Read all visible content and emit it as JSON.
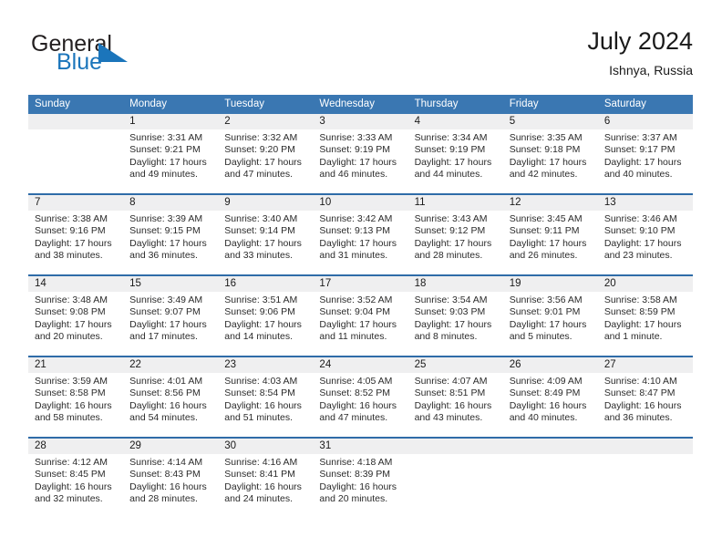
{
  "brand": {
    "name_part1": "General",
    "name_part2": "Blue",
    "mark": "triangle-flag-icon"
  },
  "header": {
    "title": "July 2024",
    "location": "Ishnya, Russia"
  },
  "calendar": {
    "weekday_headers": [
      "Sunday",
      "Monday",
      "Tuesday",
      "Wednesday",
      "Thursday",
      "Friday",
      "Saturday"
    ],
    "colors": {
      "header_blue": "#3a77b2",
      "row_rule_blue": "#2f6ca8",
      "number_band": "#efeff0",
      "brand_blue": "#1b75bb"
    },
    "weeks": [
      [
        {
          "day": "",
          "lines": []
        },
        {
          "day": "1",
          "lines": [
            "Sunrise: 3:31 AM",
            "Sunset: 9:21 PM",
            "Daylight: 17 hours",
            "and 49 minutes."
          ]
        },
        {
          "day": "2",
          "lines": [
            "Sunrise: 3:32 AM",
            "Sunset: 9:20 PM",
            "Daylight: 17 hours",
            "and 47 minutes."
          ]
        },
        {
          "day": "3",
          "lines": [
            "Sunrise: 3:33 AM",
            "Sunset: 9:19 PM",
            "Daylight: 17 hours",
            "and 46 minutes."
          ]
        },
        {
          "day": "4",
          "lines": [
            "Sunrise: 3:34 AM",
            "Sunset: 9:19 PM",
            "Daylight: 17 hours",
            "and 44 minutes."
          ]
        },
        {
          "day": "5",
          "lines": [
            "Sunrise: 3:35 AM",
            "Sunset: 9:18 PM",
            "Daylight: 17 hours",
            "and 42 minutes."
          ]
        },
        {
          "day": "6",
          "lines": [
            "Sunrise: 3:37 AM",
            "Sunset: 9:17 PM",
            "Daylight: 17 hours",
            "and 40 minutes."
          ]
        }
      ],
      [
        {
          "day": "7",
          "lines": [
            "Sunrise: 3:38 AM",
            "Sunset: 9:16 PM",
            "Daylight: 17 hours",
            "and 38 minutes."
          ]
        },
        {
          "day": "8",
          "lines": [
            "Sunrise: 3:39 AM",
            "Sunset: 9:15 PM",
            "Daylight: 17 hours",
            "and 36 minutes."
          ]
        },
        {
          "day": "9",
          "lines": [
            "Sunrise: 3:40 AM",
            "Sunset: 9:14 PM",
            "Daylight: 17 hours",
            "and 33 minutes."
          ]
        },
        {
          "day": "10",
          "lines": [
            "Sunrise: 3:42 AM",
            "Sunset: 9:13 PM",
            "Daylight: 17 hours",
            "and 31 minutes."
          ]
        },
        {
          "day": "11",
          "lines": [
            "Sunrise: 3:43 AM",
            "Sunset: 9:12 PM",
            "Daylight: 17 hours",
            "and 28 minutes."
          ]
        },
        {
          "day": "12",
          "lines": [
            "Sunrise: 3:45 AM",
            "Sunset: 9:11 PM",
            "Daylight: 17 hours",
            "and 26 minutes."
          ]
        },
        {
          "day": "13",
          "lines": [
            "Sunrise: 3:46 AM",
            "Sunset: 9:10 PM",
            "Daylight: 17 hours",
            "and 23 minutes."
          ]
        }
      ],
      [
        {
          "day": "14",
          "lines": [
            "Sunrise: 3:48 AM",
            "Sunset: 9:08 PM",
            "Daylight: 17 hours",
            "and 20 minutes."
          ]
        },
        {
          "day": "15",
          "lines": [
            "Sunrise: 3:49 AM",
            "Sunset: 9:07 PM",
            "Daylight: 17 hours",
            "and 17 minutes."
          ]
        },
        {
          "day": "16",
          "lines": [
            "Sunrise: 3:51 AM",
            "Sunset: 9:06 PM",
            "Daylight: 17 hours",
            "and 14 minutes."
          ]
        },
        {
          "day": "17",
          "lines": [
            "Sunrise: 3:52 AM",
            "Sunset: 9:04 PM",
            "Daylight: 17 hours",
            "and 11 minutes."
          ]
        },
        {
          "day": "18",
          "lines": [
            "Sunrise: 3:54 AM",
            "Sunset: 9:03 PM",
            "Daylight: 17 hours",
            "and 8 minutes."
          ]
        },
        {
          "day": "19",
          "lines": [
            "Sunrise: 3:56 AM",
            "Sunset: 9:01 PM",
            "Daylight: 17 hours",
            "and 5 minutes."
          ]
        },
        {
          "day": "20",
          "lines": [
            "Sunrise: 3:58 AM",
            "Sunset: 8:59 PM",
            "Daylight: 17 hours",
            "and 1 minute."
          ]
        }
      ],
      [
        {
          "day": "21",
          "lines": [
            "Sunrise: 3:59 AM",
            "Sunset: 8:58 PM",
            "Daylight: 16 hours",
            "and 58 minutes."
          ]
        },
        {
          "day": "22",
          "lines": [
            "Sunrise: 4:01 AM",
            "Sunset: 8:56 PM",
            "Daylight: 16 hours",
            "and 54 minutes."
          ]
        },
        {
          "day": "23",
          "lines": [
            "Sunrise: 4:03 AM",
            "Sunset: 8:54 PM",
            "Daylight: 16 hours",
            "and 51 minutes."
          ]
        },
        {
          "day": "24",
          "lines": [
            "Sunrise: 4:05 AM",
            "Sunset: 8:52 PM",
            "Daylight: 16 hours",
            "and 47 minutes."
          ]
        },
        {
          "day": "25",
          "lines": [
            "Sunrise: 4:07 AM",
            "Sunset: 8:51 PM",
            "Daylight: 16 hours",
            "and 43 minutes."
          ]
        },
        {
          "day": "26",
          "lines": [
            "Sunrise: 4:09 AM",
            "Sunset: 8:49 PM",
            "Daylight: 16 hours",
            "and 40 minutes."
          ]
        },
        {
          "day": "27",
          "lines": [
            "Sunrise: 4:10 AM",
            "Sunset: 8:47 PM",
            "Daylight: 16 hours",
            "and 36 minutes."
          ]
        }
      ],
      [
        {
          "day": "28",
          "lines": [
            "Sunrise: 4:12 AM",
            "Sunset: 8:45 PM",
            "Daylight: 16 hours",
            "and 32 minutes."
          ]
        },
        {
          "day": "29",
          "lines": [
            "Sunrise: 4:14 AM",
            "Sunset: 8:43 PM",
            "Daylight: 16 hours",
            "and 28 minutes."
          ]
        },
        {
          "day": "30",
          "lines": [
            "Sunrise: 4:16 AM",
            "Sunset: 8:41 PM",
            "Daylight: 16 hours",
            "and 24 minutes."
          ]
        },
        {
          "day": "31",
          "lines": [
            "Sunrise: 4:18 AM",
            "Sunset: 8:39 PM",
            "Daylight: 16 hours",
            "and 20 minutes."
          ]
        },
        {
          "day": "",
          "lines": []
        },
        {
          "day": "",
          "lines": []
        },
        {
          "day": "",
          "lines": []
        }
      ]
    ]
  }
}
